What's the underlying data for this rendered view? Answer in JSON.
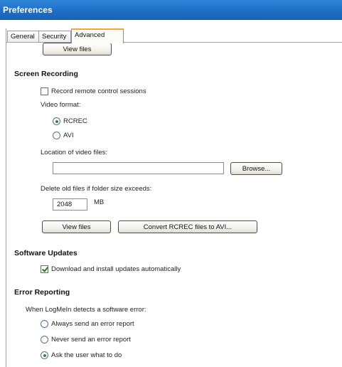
{
  "window": {
    "title": "Preferences"
  },
  "tabs": [
    {
      "label": "General"
    },
    {
      "label": "Security"
    },
    {
      "label": "Advanced"
    }
  ],
  "top": {
    "view_files_label": "View files"
  },
  "screen_recording": {
    "title": "Screen Recording",
    "record_sessions_label": "Record remote control sessions",
    "record_sessions_checked": false,
    "video_format_label": "Video format:",
    "format_options": [
      "RCREC",
      "AVI"
    ],
    "format_selected": "RCREC",
    "location_label": "Location of video files:",
    "location_value": "",
    "browse_label": "Browse...",
    "delete_label": "Delete old files if folder size exceeds:",
    "size_value": "2048",
    "size_unit": "MB",
    "view_files_label": "View files",
    "convert_label": "Convert RCREC files to AVI..."
  },
  "software_updates": {
    "title": "Software Updates",
    "auto_update_label": "Download and install updates automatically",
    "auto_update_checked": true
  },
  "error_reporting": {
    "title": "Error Reporting",
    "intro_label": "When LogMeIn detects a software error:",
    "options": [
      "Always send an error report",
      "Never send an error report",
      "Ask the user what to do"
    ],
    "selected": "Ask the user what to do"
  }
}
